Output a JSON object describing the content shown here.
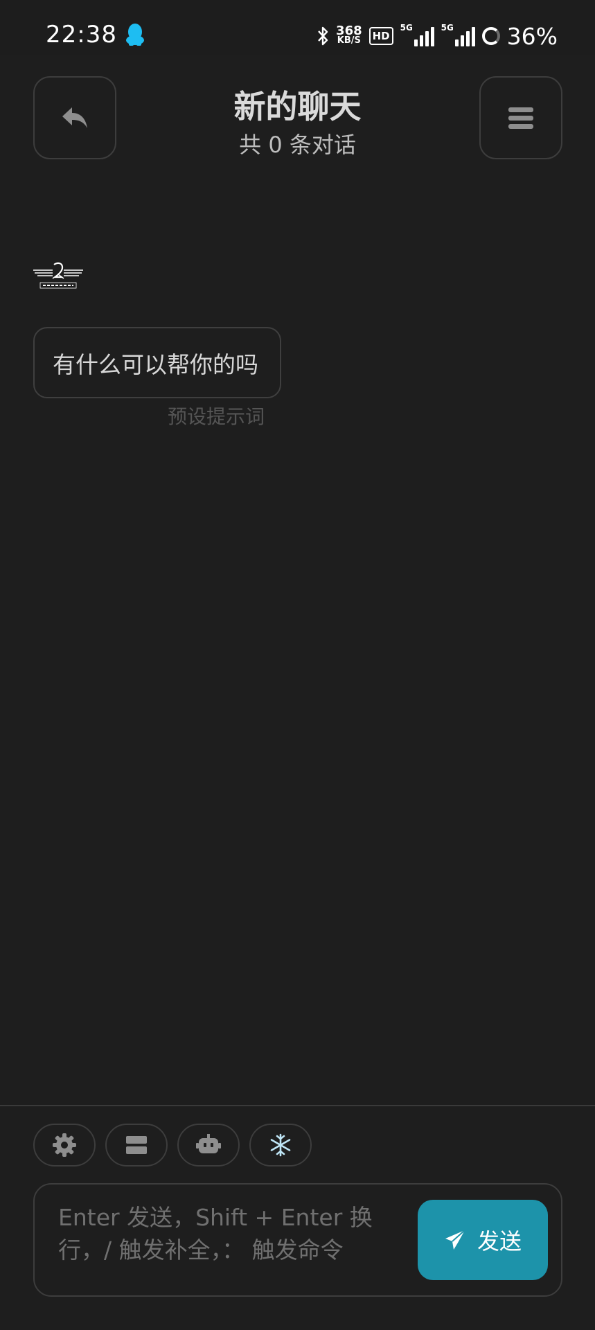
{
  "status_bar": {
    "time": "22:38",
    "net_speed_value": "368",
    "net_speed_unit": "KB/S",
    "hd_label": "HD",
    "signal1_label": "5G",
    "signal2_label": "5G",
    "battery": "36%",
    "icons": [
      "qq-icon",
      "bluetooth-icon",
      "signal-icon",
      "battery-ring-icon"
    ]
  },
  "header": {
    "title": "新的聊天",
    "subtitle": "共 0 条对话",
    "back_icon": "reply-arrow-icon",
    "menu_icon": "menu-icon"
  },
  "messages": [
    {
      "role": "assistant",
      "avatar": "chat-rf-logo",
      "text": "有什么可以帮你的吗",
      "meta": "预设提示词"
    }
  ],
  "toolbar": {
    "tools": [
      "gear-icon",
      "server-icon",
      "robot-icon",
      "snowflake-icon"
    ],
    "accent": "#1d93aa"
  },
  "input": {
    "placeholder": "Enter 发送，Shift + Enter 换行，/ 触发补全，：  触发命令",
    "send_label": "发送",
    "send_icon": "send-icon"
  },
  "colors": {
    "background": "#1e1e1e",
    "border": "#3d3d3d",
    "accent": "#1d93aa",
    "qq_blue": "#1ebdf2"
  }
}
